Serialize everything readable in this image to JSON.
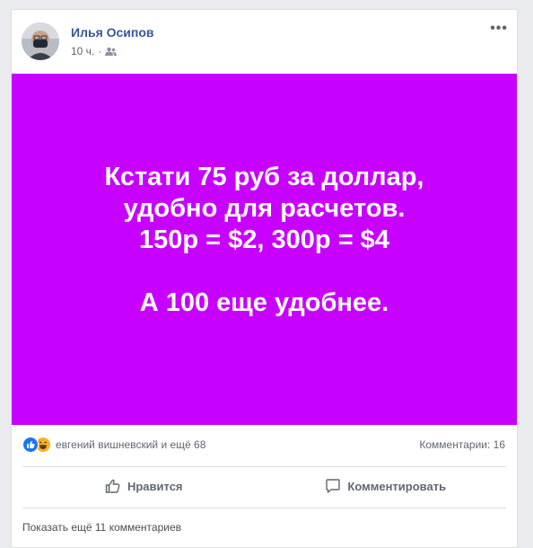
{
  "post": {
    "author": "Илья Осипов",
    "time": "10 ч.",
    "audience_icon": "friends-icon",
    "more_icon": "ellipsis-icon",
    "more_label": "•••",
    "image": {
      "background": "#c800ff",
      "text": "Кстати 75 руб за доллар,\nудобно для расчетов.\n150р = $2, 300р = $4\n\nА 100 еще удобнее."
    }
  },
  "reactions": {
    "icons": [
      "like-reaction-icon",
      "haha-reaction-icon"
    ],
    "summary": "евгений вишневский и ещё 68"
  },
  "comments": {
    "count_label": "Комментарии: 16",
    "show_more": "Показать ещё 11 комментариев"
  },
  "actions": {
    "like": "Нравится",
    "comment": "Комментировать"
  },
  "colors": {
    "accent": "#385898",
    "post_bg": "#c800ff",
    "like_blue": "#1877f2"
  }
}
